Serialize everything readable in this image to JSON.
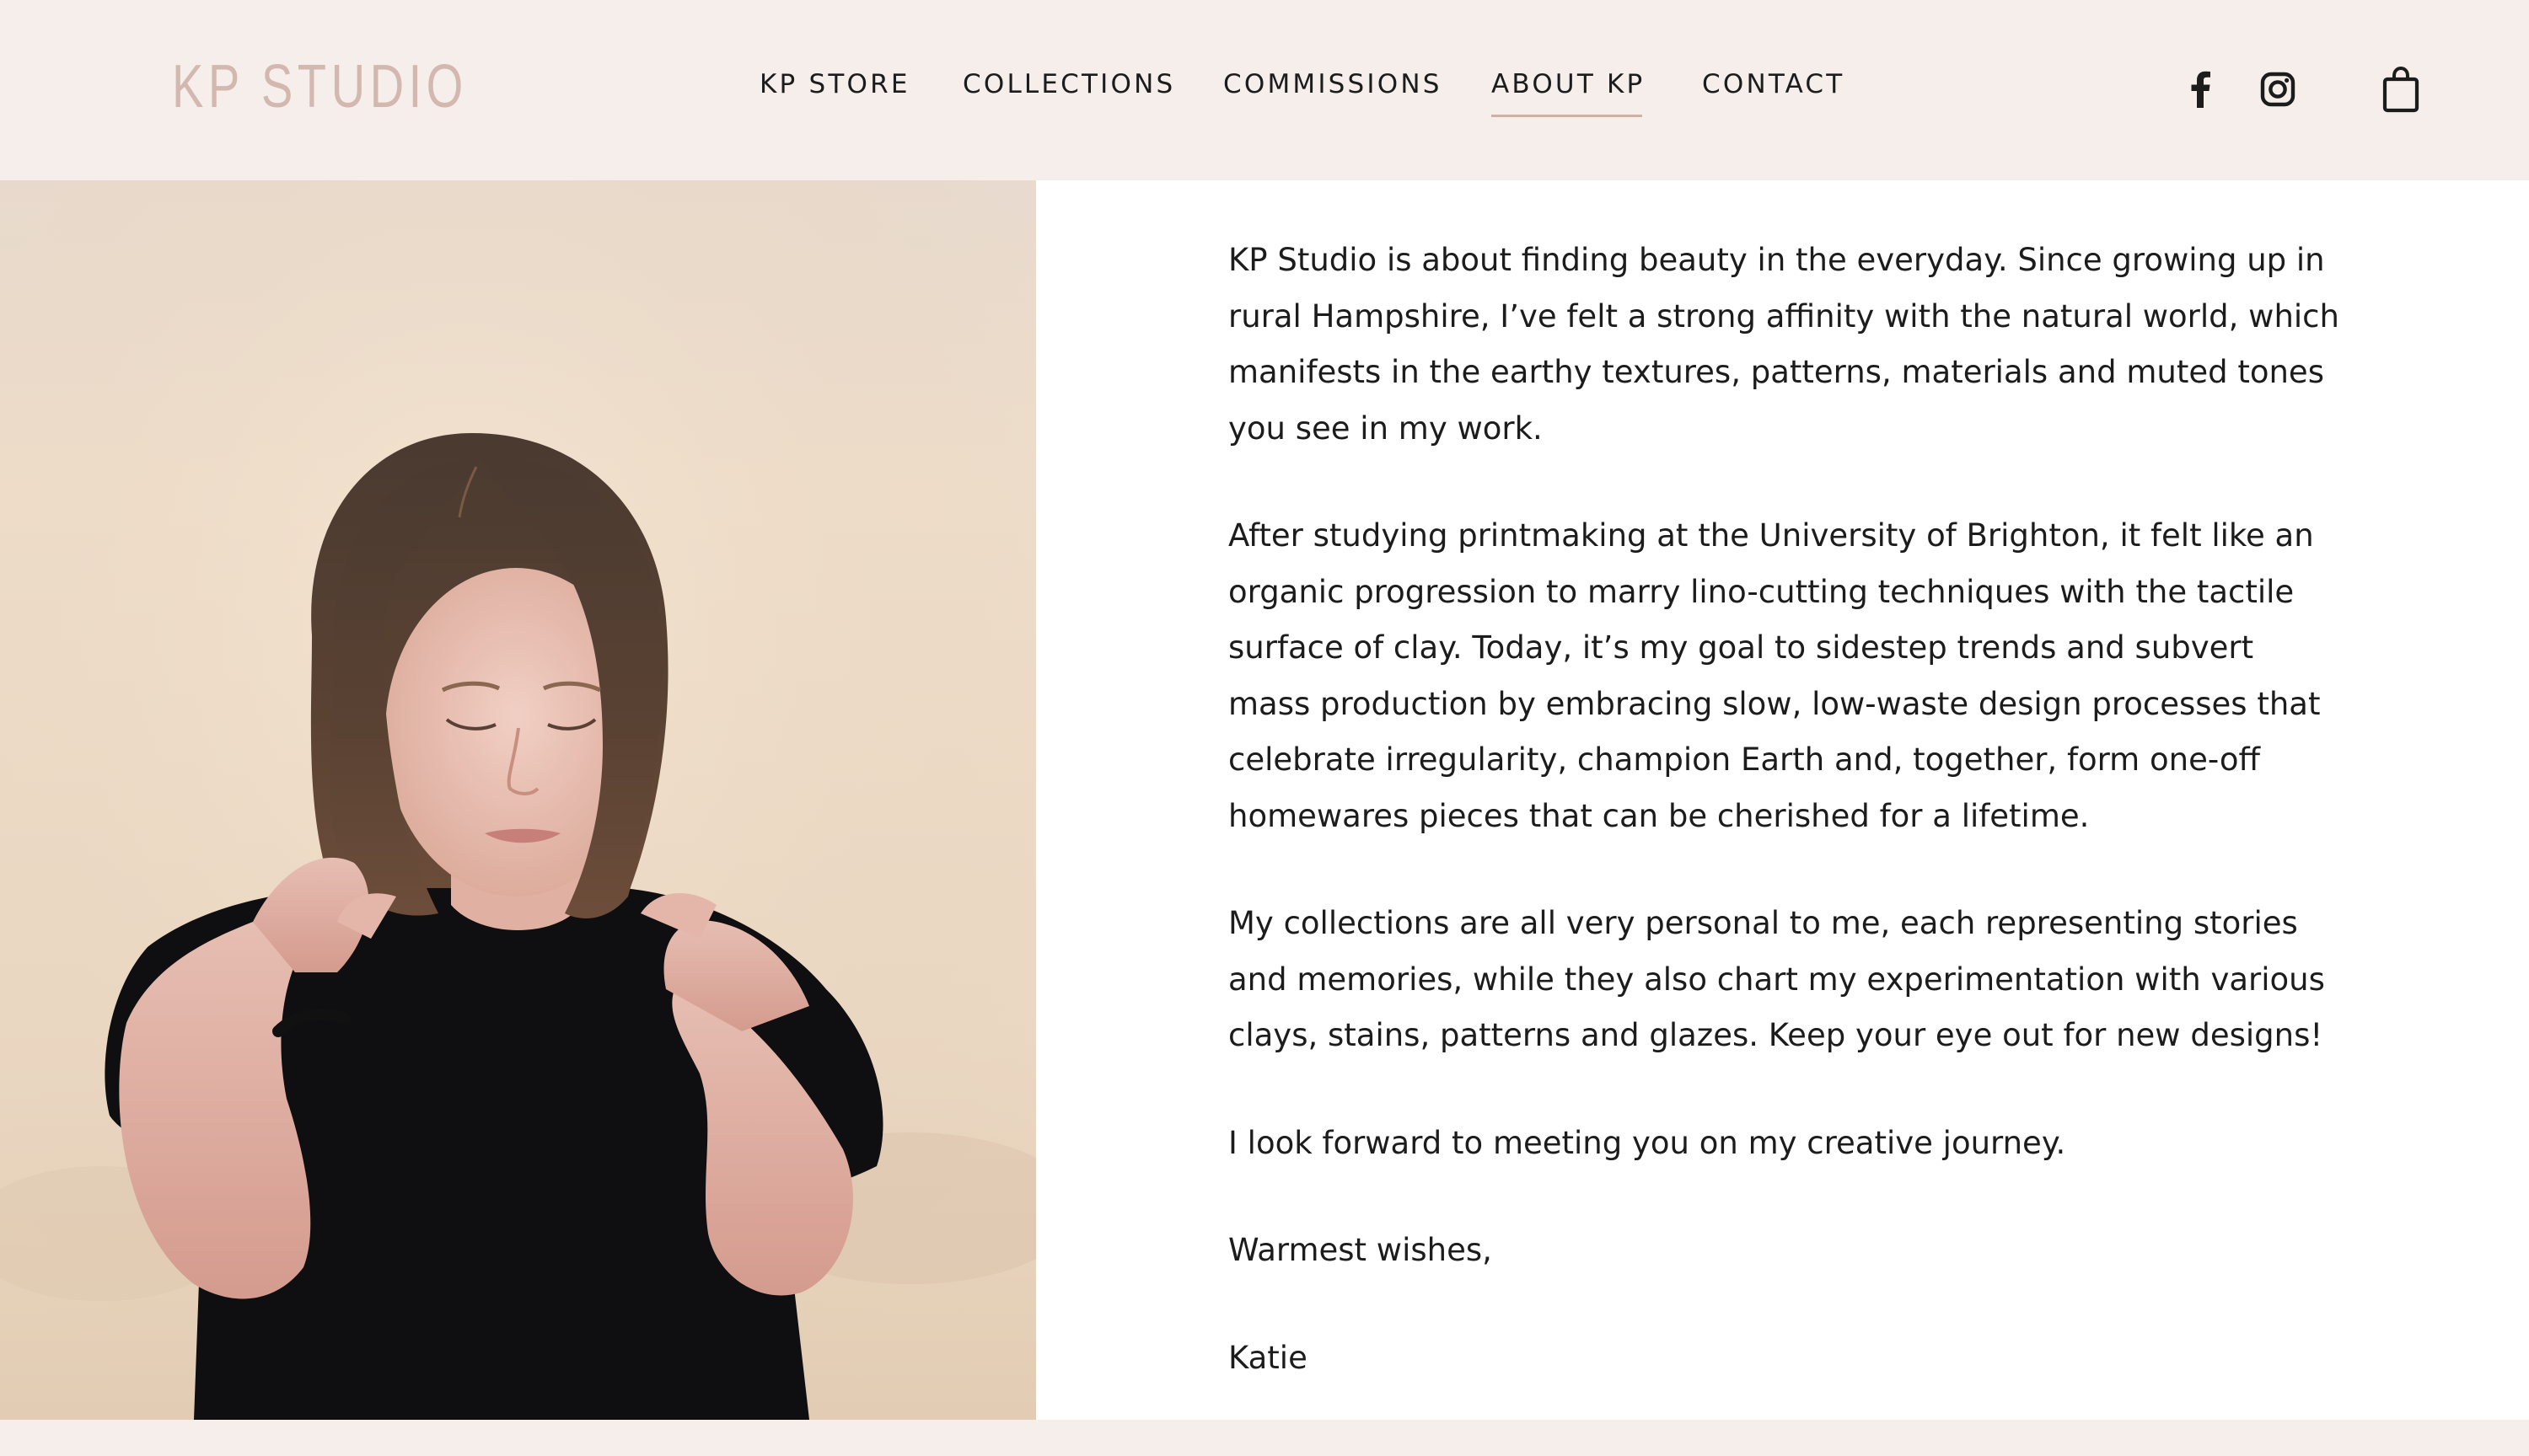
{
  "brand": {
    "logo_text": "KP STUDIO",
    "logo_color": "#d3b8b0",
    "background": "#f5eeea"
  },
  "nav": {
    "items": [
      {
        "label": "KP STORE",
        "active": false
      },
      {
        "label": "COLLECTIONS",
        "active": false
      },
      {
        "label": "COMMISSIONS",
        "active": false
      },
      {
        "label": "ABOUT KP",
        "active": true
      },
      {
        "label": "CONTACT",
        "active": false
      }
    ],
    "accent": "#cfb1a7"
  },
  "social": {
    "icons": [
      "facebook-icon",
      "instagram-icon",
      "shopping-bag-icon"
    ]
  },
  "about": {
    "photo_icon": "portrait-photo",
    "paragraphs": [
      "KP Studio is about finding beauty in the everyday. Since growing up in rural Hampshire, I’ve felt a strong affinity with the natural world, which manifests in the earthy textures, patterns, materials and muted tones you see in my work.",
      "After studying printmaking at the University of Brighton, it felt like an organic progression to marry lino-cutting techniques with the tactile surface of clay. Today, it’s my goal to sidestep trends and subvert mass production by embracing slow, low-waste design processes that celebrate irregularity, champion Earth and, together, form one-off homewares pieces that can be cherished for a lifetime.",
      "My collections are all very personal to me, each representing stories and memories, while they also chart my experimentation with various clays, stains, patterns and glazes. Keep your eye out for new designs!",
      "I look forward to meeting you on my creative journey.",
      "Warmest wishes,",
      "Katie"
    ]
  }
}
